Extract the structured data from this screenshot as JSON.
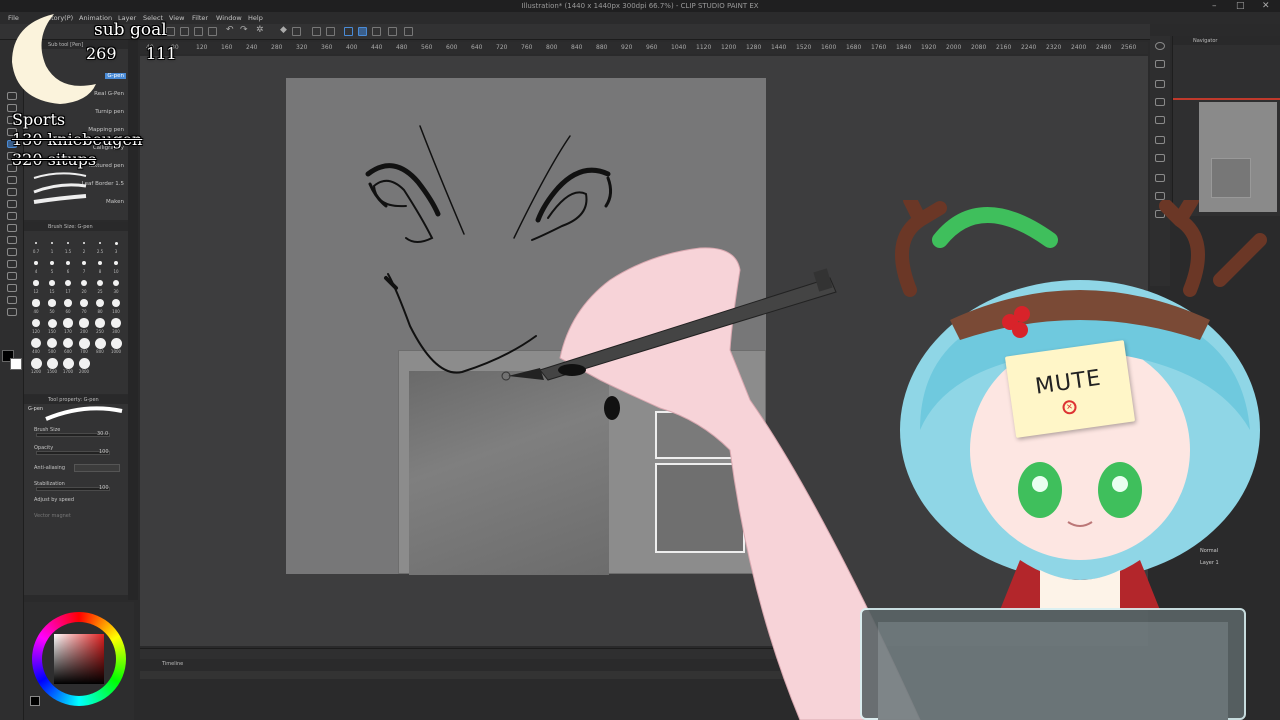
{
  "window": {
    "title": "Illustration* (1440 x 1440px 300dpi 66.7%) - CLIP STUDIO PAINT EX"
  },
  "menu": {
    "items": [
      "File",
      "Story(P)",
      "Animation",
      "Layer",
      "Select",
      "View",
      "Filter",
      "Window",
      "Help"
    ]
  },
  "ruler": {
    "ticks": [
      "40",
      "80",
      "120",
      "160",
      "240",
      "280",
      "320",
      "360",
      "400",
      "440",
      "480",
      "560",
      "600",
      "640",
      "720",
      "760",
      "800",
      "840",
      "880",
      "920",
      "960",
      "1040",
      "1120",
      "1200",
      "1280",
      "1440",
      "1520",
      "1600",
      "1680",
      "1760",
      "1840",
      "1920",
      "2000",
      "2080",
      "2160",
      "2240",
      "2320",
      "2400",
      "2480",
      "2560"
    ]
  },
  "sub_tool": {
    "tab": "Sub tool [Pen]",
    "brushes": [
      "G-pen",
      "Real G-Pen",
      "Turnip pen",
      "Mapping pen",
      "Calligraphy",
      "Textured pen",
      "Leaf Border 1.5",
      "Maken"
    ]
  },
  "brush_size": {
    "tab": "Brush Size: G-pen",
    "sizes": [
      "0.7",
      "1",
      "1.5",
      "2",
      "2.5",
      "3",
      "4",
      "5",
      "6",
      "7",
      "8",
      "10",
      "12",
      "15",
      "17",
      "20",
      "25",
      "30",
      "40",
      "50",
      "60",
      "70",
      "80",
      "100",
      "120",
      "150",
      "170",
      "200",
      "250",
      "300",
      "400",
      "500",
      "600",
      "700",
      "800",
      "1000",
      "1200",
      "1500",
      "1700",
      "2000"
    ]
  },
  "tool_property": {
    "tab": "Tool property: G-pen",
    "brush_name": "G-pen",
    "fields": [
      {
        "label": "Brush Size",
        "value": "30.0"
      },
      {
        "label": "Opacity",
        "value": "100"
      },
      {
        "label": "Anti-aliasing",
        "value": ""
      },
      {
        "label": "Stabilization",
        "value": "100"
      },
      {
        "label": "Adjust by speed",
        "value": ""
      },
      {
        "label": "Vector magnet",
        "value": ""
      }
    ]
  },
  "navigator": {
    "tab": "Navigator"
  },
  "layer_panel": {
    "blend_mode": "Normal",
    "layer_label": "Layer 1"
  },
  "timeline": {
    "tab": "Timeline"
  },
  "colors": {
    "accent": "#4a8bd6",
    "canvas": "#777778",
    "ui_bg": "#2a2a2b",
    "ink": "#111111"
  },
  "overlay": {
    "sub_goal_label": "sub goal",
    "sub_goal_value": "269",
    "sub_goal_progress": "111",
    "sports_title": "Sports",
    "sports_line1": "130 kniebeugen",
    "sports_line2": "320 situps",
    "mute_note": "MUTE"
  }
}
